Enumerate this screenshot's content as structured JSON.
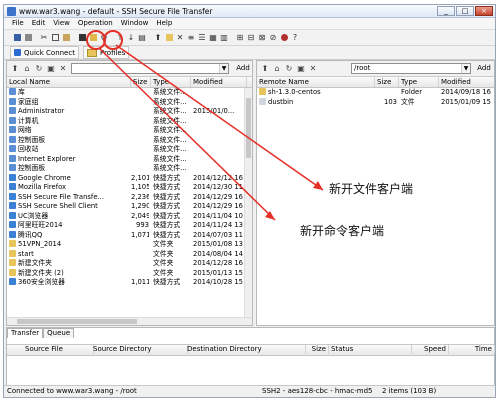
{
  "window": {
    "title": "www.war3.wang - default - SSH Secure File Transfer",
    "minimize": "_",
    "maximize": "□",
    "close": "×"
  },
  "menu": [
    "File",
    "Edit",
    "View",
    "Operation",
    "Window",
    "Help"
  ],
  "toolbar_icons": [
    "save-icon",
    "print-icon",
    "cut-icon",
    "copy-icon",
    "paste-icon",
    "new-terminal-icon",
    "new-file-transfer-icon",
    "settings-icon",
    "upload-icon",
    "download-icon",
    "view-icon",
    "up-folder-icon",
    "new-folder-icon",
    "delete-icon",
    "rename-icon",
    "properties-icon",
    "details-icon",
    "list-icon",
    "binary-icon",
    "ascii-icon",
    "auto-icon",
    "stop-icon",
    "help-icon",
    "about-icon"
  ],
  "quickbar": {
    "quick_connect": "Quick Connect",
    "profiles": "Profiles"
  },
  "local": {
    "path": "",
    "add": "Add",
    "columns": {
      "name": "Local Name",
      "size": "Size",
      "type": "Type",
      "modified": "Modified"
    },
    "rows": [
      {
        "name": "库",
        "size": "",
        "type": "系统文件...",
        "modified": ""
      },
      {
        "name": "家庭组",
        "size": "",
        "type": "系统文件...",
        "modified": ""
      },
      {
        "name": "Administrator",
        "size": "",
        "type": "系统文件...",
        "modified": "2015/01/0..."
      },
      {
        "name": "计算机",
        "size": "",
        "type": "系统文件...",
        "modified": ""
      },
      {
        "name": "网络",
        "size": "",
        "type": "系统文件...",
        "modified": ""
      },
      {
        "name": "控制面板",
        "size": "",
        "type": "系统文件...",
        "modified": ""
      },
      {
        "name": "回收站",
        "size": "",
        "type": "系统文件...",
        "modified": ""
      },
      {
        "name": "Internet Explorer",
        "size": "",
        "type": "系统文件...",
        "modified": ""
      },
      {
        "name": "控制面板",
        "size": "",
        "type": "系统文件...",
        "modified": ""
      },
      {
        "name": "Google Chrome",
        "size": "2,101",
        "type": "快捷方式",
        "modified": "2014/12/12 16"
      },
      {
        "name": "Mozilla Firefox",
        "size": "1,105",
        "type": "快捷方式",
        "modified": "2014/12/30 11"
      },
      {
        "name": "SSH Secure File Transfe...",
        "size": "2,236",
        "type": "快捷方式",
        "modified": "2014/12/29 16"
      },
      {
        "name": "SSH Secure Shell Client",
        "size": "1,290",
        "type": "快捷方式",
        "modified": "2014/12/29 16"
      },
      {
        "name": "UC浏览器",
        "size": "2,049",
        "type": "快捷方式",
        "modified": "2014/11/04 10"
      },
      {
        "name": "阿里旺旺2014",
        "size": "993",
        "type": "快捷方式",
        "modified": "2014/11/24 13"
      },
      {
        "name": "腾讯QQ",
        "size": "1,071",
        "type": "快捷方式",
        "modified": "2014/07/03 11"
      },
      {
        "name": "51VPN_2014",
        "size": "",
        "type": "文件夹",
        "modified": "2015/01/08 13"
      },
      {
        "name": "start",
        "size": "",
        "type": "文件夹",
        "modified": "2014/08/04 14"
      },
      {
        "name": "新建文件夹",
        "size": "",
        "type": "文件夹",
        "modified": "2014/12/28 16"
      },
      {
        "name": "新建文件夹 (2)",
        "size": "",
        "type": "文件夹",
        "modified": "2015/01/13 15"
      },
      {
        "name": "360安全浏览器",
        "size": "1,011",
        "type": "快捷方式",
        "modified": "2014/10/28 15"
      }
    ]
  },
  "remote": {
    "path": "/root",
    "add": "Add",
    "columns": {
      "name": "Remote Name",
      "size": "Size",
      "type": "Type",
      "modified": "Modified"
    },
    "rows": [
      {
        "name": "sh-1.3.0-centos",
        "size": "",
        "type": "Folder",
        "modified": "2014/09/18 16"
      },
      {
        "name": "dustbin",
        "size": "103",
        "type": "文件",
        "modified": "2015/01/09 15"
      }
    ]
  },
  "transfer": {
    "tabs": [
      "Transfer",
      "Queue"
    ],
    "columns": [
      "Source File",
      "Source Directory",
      "Destination Directory",
      "Size",
      "Status",
      "Speed",
      "Time"
    ]
  },
  "status": {
    "connection": "Connected to www.war3.wang - /root",
    "cipher": "SSH2 - aes128-cbc - hmac-md5",
    "items": "2 items (103 B)"
  },
  "annotations": {
    "file_client": "新开文件客户端",
    "command_client": "新开命令客户端"
  },
  "colors": {
    "annotation_red": "#e53027",
    "folder": "#e7c55c",
    "selection": "#3399ff"
  }
}
